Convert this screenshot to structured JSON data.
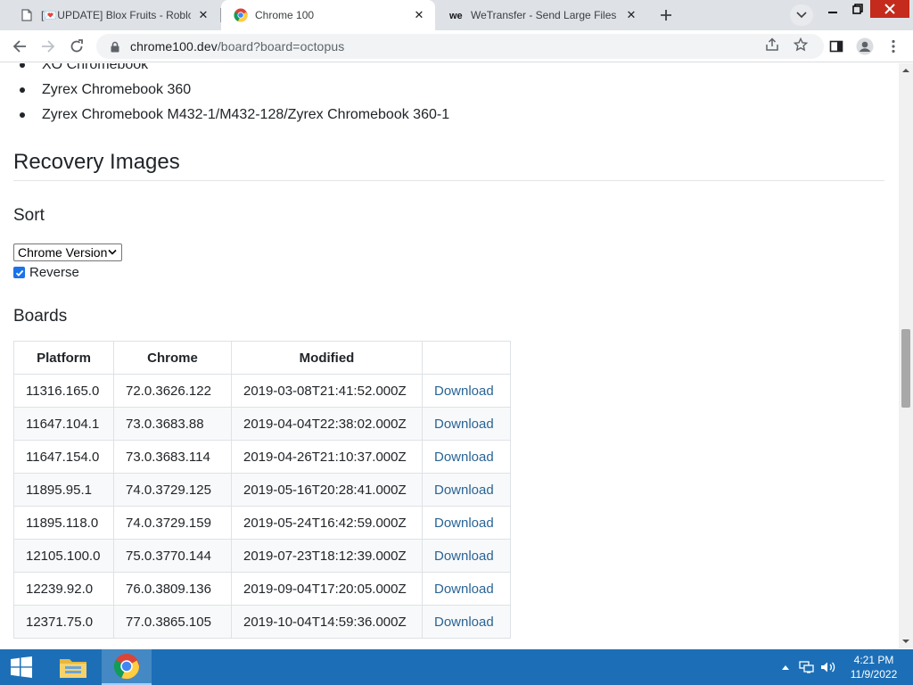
{
  "browser": {
    "tabs": [
      {
        "title": "[💌UPDATE] Blox Fruits - Roblo",
        "active": false
      },
      {
        "title": "Chrome 100",
        "active": true
      },
      {
        "title": "WeTransfer - Send Large Files &",
        "active": false
      }
    ],
    "url_host": "chrome100.dev",
    "url_rest": "/board?board=octopus"
  },
  "page": {
    "devices": [
      "XO Chromebook",
      "Zyrex Chromebook 360",
      "Zyrex Chromebook M432-1/M432-128/Zyrex Chromebook 360-1"
    ],
    "recovery_heading": "Recovery Images",
    "sort_heading": "Sort",
    "sort_selected": "Chrome Version",
    "reverse_label": "Reverse",
    "reverse_checked": true,
    "boards_heading": "Boards",
    "table": {
      "headers": [
        "Platform",
        "Chrome",
        "Modified",
        ""
      ],
      "rows": [
        {
          "platform": "11316.165.0",
          "chrome": "72.0.3626.122",
          "modified": "2019-03-08T21:41:52.000Z",
          "action": "Download"
        },
        {
          "platform": "11647.104.1",
          "chrome": "73.0.3683.88",
          "modified": "2019-04-04T22:38:02.000Z",
          "action": "Download"
        },
        {
          "platform": "11647.154.0",
          "chrome": "73.0.3683.114",
          "modified": "2019-04-26T21:10:37.000Z",
          "action": "Download"
        },
        {
          "platform": "11895.95.1",
          "chrome": "74.0.3729.125",
          "modified": "2019-05-16T20:28:41.000Z",
          "action": "Download"
        },
        {
          "platform": "11895.118.0",
          "chrome": "74.0.3729.159",
          "modified": "2019-05-24T16:42:59.000Z",
          "action": "Download"
        },
        {
          "platform": "12105.100.0",
          "chrome": "75.0.3770.144",
          "modified": "2019-07-23T18:12:39.000Z",
          "action": "Download"
        },
        {
          "platform": "12239.92.0",
          "chrome": "76.0.3809.136",
          "modified": "2019-09-04T17:20:05.000Z",
          "action": "Download"
        },
        {
          "platform": "12371.75.0",
          "chrome": "77.0.3865.105",
          "modified": "2019-10-04T14:59:36.000Z",
          "action": "Download"
        }
      ]
    }
  },
  "taskbar": {
    "time": "4:21 PM",
    "date": "11/9/2022",
    "apps": [
      "file-explorer",
      "chrome"
    ]
  },
  "colors": {
    "link": "#2a6496",
    "taskbar": "#1c6fb7",
    "tabstrip": "#dee1e6"
  }
}
